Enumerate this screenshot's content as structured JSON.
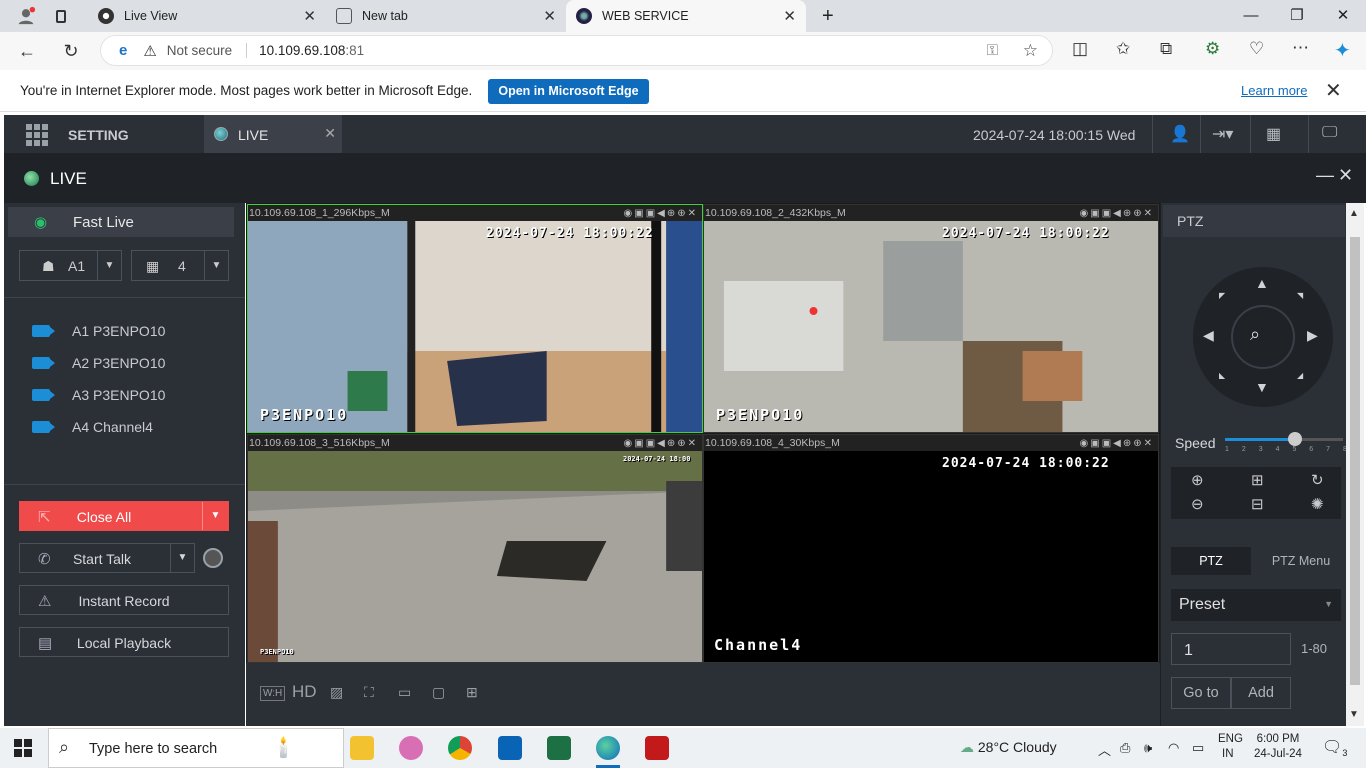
{
  "browser": {
    "tabs": [
      {
        "label": "Live View",
        "active": false
      },
      {
        "label": "New tab",
        "active": false
      },
      {
        "label": "WEB SERVICE",
        "active": true
      }
    ],
    "new_tab_icon": "plus-icon",
    "address": {
      "security_label": "Not secure",
      "host": "10.109.69.108",
      "port": ":81"
    },
    "ie_bar": {
      "message": "You're in Internet Explorer mode. Most pages work better in Microsoft Edge.",
      "open_button": "Open in Microsoft Edge",
      "learn_more": "Learn more"
    }
  },
  "app": {
    "topnav": {
      "setting_label": "SETTING",
      "live_tab_label": "LIVE",
      "datetime": "2024-07-24 18:00:15 Wed"
    },
    "live_header": {
      "title": "LIVE"
    },
    "left_panel": {
      "fast_live": "Fast Live",
      "group_select": "A1",
      "layout_select": "4",
      "channels": [
        {
          "label": "A1 P3ENPO10"
        },
        {
          "label": "A2 P3ENPO10"
        },
        {
          "label": "A3 P3ENPO10"
        },
        {
          "label": "A4 Channel4"
        }
      ],
      "actions": {
        "close_all": "Close All",
        "start_talk": "Start Talk",
        "instant_record": "Instant Record",
        "local_playback": "Local Playback"
      }
    },
    "video": {
      "cells": [
        {
          "info": "10.109.69.108_1_296Kbps_M",
          "timestamp": "2024-07-24 18:00:22",
          "name": "P3ENPO10",
          "selected": true
        },
        {
          "info": "10.109.69.108_2_432Kbps_M",
          "timestamp": "2024-07-24 18:00:22",
          "name": "P3ENPO10",
          "selected": false
        },
        {
          "info": "10.109.69.108_3_516Kbps_M",
          "timestamp": "2024-07-24 18:00",
          "name": "P3ENPO10",
          "selected": false
        },
        {
          "info": "10.109.69.108_4_30Kbps_M",
          "timestamp": "2024-07-24 18:00:22",
          "name": "Channel4",
          "selected": false
        }
      ],
      "bottom_hd_label": "HD",
      "bottom_wh_label": "W:H"
    },
    "ptz": {
      "header": "PTZ",
      "speed_label": "Speed",
      "speed_value": 5,
      "speed_ticks": [
        "1",
        "2",
        "3",
        "4",
        "5",
        "6",
        "7",
        "8"
      ],
      "tabs": {
        "ptz": "PTZ",
        "ptz_menu": "PTZ Menu"
      },
      "preset_label": "Preset",
      "preset_value": "1",
      "preset_range": "1-80",
      "goto": "Go to",
      "add": "Add"
    }
  },
  "taskbar": {
    "search_placeholder": "Type here to search",
    "weather": "28°C  Cloudy",
    "lang_line1": "ENG",
    "lang_line2": "IN",
    "time": "6:00 PM",
    "date": "24-Jul-24",
    "notifications": "3"
  }
}
